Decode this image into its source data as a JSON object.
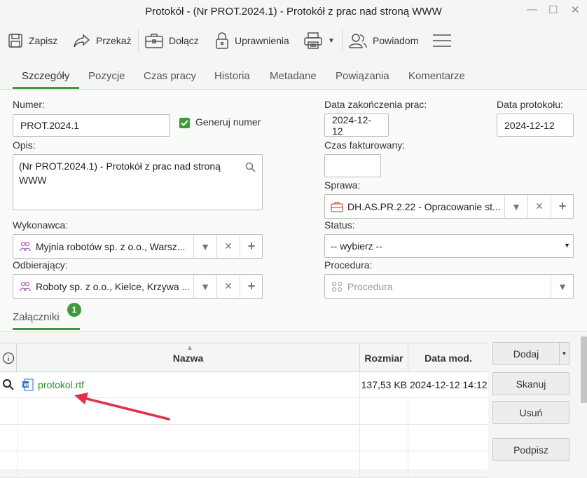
{
  "window": {
    "title": "Protokół - (Nr PROT.2024.1) - Protokół z prac nad stroną WWW",
    "minimize": "—",
    "maximize": "☐",
    "close": "✕"
  },
  "toolbar": {
    "save": "Zapisz",
    "forward": "Przekaż",
    "attach": "Dołącz",
    "permissions": "Uprawnienia",
    "notify": "Powiadom"
  },
  "tabs": [
    {
      "label": "Szczegóły"
    },
    {
      "label": "Pozycje"
    },
    {
      "label": "Czas pracy"
    },
    {
      "label": "Historia"
    },
    {
      "label": "Metadane"
    },
    {
      "label": "Powiązania"
    },
    {
      "label": "Komentarze"
    }
  ],
  "form": {
    "numer_label": "Numer:",
    "numer_value": "PROT.2024.1",
    "generuj_label": "Generuj numer",
    "opis_label": "Opis:",
    "opis_value": "(Nr PROT.2024.1) - Protokół z prac nad stroną WWW",
    "wykonawca_label": "Wykonawca:",
    "wykonawca_value": "Myjnia robotów sp. z o.o., Warsz...",
    "odbierajacy_label": "Odbierający:",
    "odbierajacy_value": "Roboty sp. z o.o., Kielce, Krzywa ...",
    "data_zak_label": "Data zakończenia prac:",
    "data_zak_value": "2024-12-12",
    "data_prot_label": "Data protokołu:",
    "data_prot_value": "2024-12-12",
    "czas_fakt_label": "Czas fakturowany:",
    "czas_fakt_value": "",
    "sprawa_label": "Sprawa:",
    "sprawa_value": "DH.AS.PR.2.22 - Opracowanie st...",
    "status_label": "Status:",
    "status_value": "-- wybierz --",
    "procedura_label": "Procedura:",
    "procedura_placeholder": "Procedura"
  },
  "attachments": {
    "tab_label": "Załączniki",
    "count": "1",
    "columns": {
      "name": "Nazwa",
      "size": "Rozmiar",
      "date": "Data mod."
    },
    "rows": [
      {
        "name": "protokol.rtf",
        "size": "137,53 KB",
        "date": "2024-12-12 14:12"
      }
    ],
    "buttons": {
      "add": "Dodaj",
      "scan": "Skanuj",
      "remove": "Usuń",
      "sign": "Podpisz"
    }
  },
  "colors": {
    "accent": "#3d9a3d",
    "arrow": "#e0314a",
    "link": "#2e8b2e"
  }
}
